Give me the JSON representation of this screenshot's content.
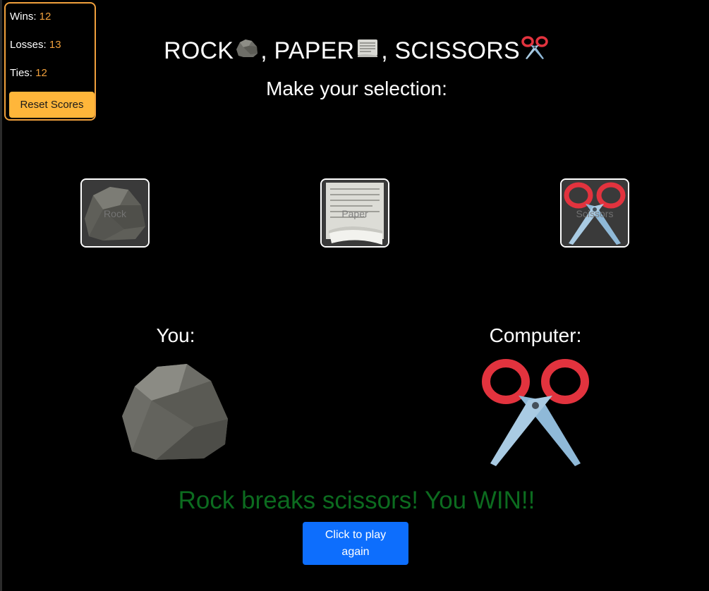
{
  "scoreboard": {
    "wins_label": "Wins:",
    "wins_value": "12",
    "losses_label": "Losses:",
    "losses_value": "13",
    "ties_label": "Ties:",
    "ties_value": "12",
    "reset_label": "Reset Scores"
  },
  "title": {
    "rock": "ROCK",
    "paper": ", PAPER",
    "scissors": ", SCISSORS",
    "rock_icon": "rock-icon",
    "paper_icon": "newspaper-icon",
    "scissors_icon": "scissors-icon"
  },
  "subtitle": "Make your selection:",
  "choices": [
    {
      "label": "Rock",
      "icon": "rock-icon"
    },
    {
      "label": "Paper",
      "icon": "paper-icon"
    },
    {
      "label": "Scissors",
      "icon": "scissors-icon"
    }
  ],
  "you": {
    "label": "You:",
    "pick_icon": "rock-icon"
  },
  "computer": {
    "label": "Computer:",
    "pick_icon": "scissors-icon"
  },
  "result": "Rock breaks scissors! You WIN!!",
  "play_again_label": "Click to play again",
  "colors": {
    "accent": "#f0a03c",
    "reset_button": "#ffb63a",
    "win_text": "#0c6b1f",
    "primary_button": "#0d6efd",
    "background": "#000000"
  }
}
